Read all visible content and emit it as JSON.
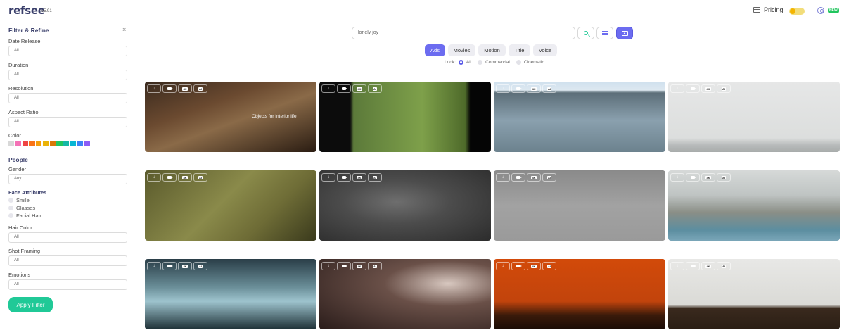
{
  "header": {
    "logo": "refsee",
    "version": "v5.91",
    "pricing": "Pricing",
    "coin_count": "1",
    "new_badge": "NEW"
  },
  "sidebar": {
    "title": "Filter & Refine",
    "close": "×",
    "date_release": {
      "label": "Date Release",
      "value": "All"
    },
    "duration": {
      "label": "Duration",
      "value": "All"
    },
    "resolution": {
      "label": "Resolution",
      "value": "All"
    },
    "aspect_ratio": {
      "label": "Aspect Ratio",
      "value": "All"
    },
    "color": {
      "label": "Color",
      "swatches": [
        "#d8d8d8",
        "#f472b6",
        "#ef4444",
        "#f97316",
        "#f59e0b",
        "#eab308",
        "#d97706",
        "#22c55e",
        "#14b8a6",
        "#06b6d4",
        "#3b82f6",
        "#8b5cf6"
      ]
    },
    "people_heading": "People",
    "gender": {
      "label": "Gender",
      "value": "Any"
    },
    "face_attributes": {
      "label": "Face Attributes",
      "options": [
        "Smile",
        "Glasses",
        "Facial Hair"
      ]
    },
    "hair_color": {
      "label": "Hair Color",
      "value": "All"
    },
    "shot_framing": {
      "label": "Shot Framing",
      "value": "All"
    },
    "emotions": {
      "label": "Emotions",
      "value": "All"
    },
    "apply_button": "Apply Filter"
  },
  "search": {
    "value": "lonely joy"
  },
  "tabs": [
    "Ads",
    "Movies",
    "Motion",
    "Title",
    "Voice"
  ],
  "active_tab": "Ads",
  "look": {
    "label": "Look:",
    "options": [
      "All",
      "Commercial",
      "Cinematic"
    ],
    "selected": "All"
  },
  "card_toolbar": {
    "download": "↓",
    "tag_a": "4K",
    "tag_b": "AI"
  },
  "results": [
    {
      "overlay": "Objects for Interior life"
    },
    {
      "overlay": ""
    },
    {
      "overlay": ""
    },
    {
      "overlay": ""
    },
    {
      "overlay": ""
    },
    {
      "overlay": ""
    },
    {
      "overlay": ""
    },
    {
      "overlay": ""
    },
    {
      "overlay": ""
    },
    {
      "overlay": ""
    },
    {
      "overlay": ""
    },
    {
      "overlay": ""
    }
  ]
}
